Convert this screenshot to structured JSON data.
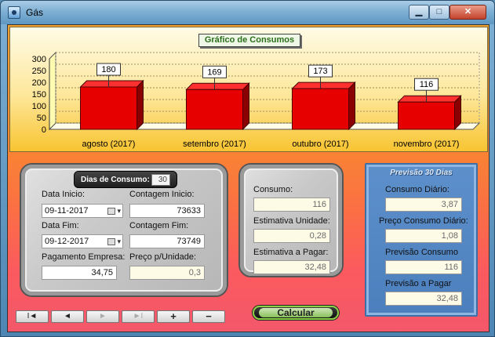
{
  "window": {
    "title": "Gás",
    "minimize": "▁",
    "maximize": "□",
    "close": "✕"
  },
  "chart_data": {
    "type": "bar",
    "title": "Gráfico de Consumos",
    "categories": [
      "agosto (2017)",
      "setembro (2017)",
      "outubro (2017)",
      "novembro (2017)"
    ],
    "values": [
      180,
      169,
      173,
      116
    ],
    "ylim": [
      0,
      300
    ],
    "yticks": [
      "300",
      "250",
      "200",
      "150",
      "100",
      "50",
      "0"
    ],
    "bar_color": "#e60000",
    "grid": true
  },
  "left_panel": {
    "dias_label": "Dias de Consumo:",
    "dias_value": "30",
    "data_inicio_label": "Data Inicio:",
    "data_inicio_value": "09-11-2017",
    "contagem_inicio_label": "Contagem Inicio:",
    "contagem_inicio_value": "73633",
    "data_fim_label": "Data Fim:",
    "data_fim_value": "09-12-2017",
    "contagem_fim_label": "Contagem Fim:",
    "contagem_fim_value": "73749",
    "pagamento_label": "Pagamento Empresa:",
    "pagamento_value": "34,75",
    "preco_label": "Preço p/Unidade:",
    "preco_value": "0,3"
  },
  "mid_panel": {
    "consumo_label": "Consumo:",
    "consumo_value": "116",
    "estimativa_unidade_label": "Estimativa Unidade:",
    "estimativa_unidade_value": "0,28",
    "estimativa_pagar_label": "Estimativa a Pagar:",
    "estimativa_pagar_value": "32,48"
  },
  "right_panel": {
    "title": "Previsão 30 Dias",
    "consumo_diario_label": "Consumo Diário:",
    "consumo_diario_value": "3,87",
    "preco_consumo_label": "Preço Consumo Diário:",
    "preco_consumo_value": "1,08",
    "previsao_consumo_label": "Previsão Consumo",
    "previsao_consumo_value": "116",
    "previsao_pagar_label": "Previsão a Pagar",
    "previsao_pagar_value": "32,48"
  },
  "nav": {
    "first": "I◄",
    "prev": "◄",
    "next": "►",
    "last": "►I",
    "add": "+",
    "remove": "−"
  },
  "calcular_label": "Calcular"
}
